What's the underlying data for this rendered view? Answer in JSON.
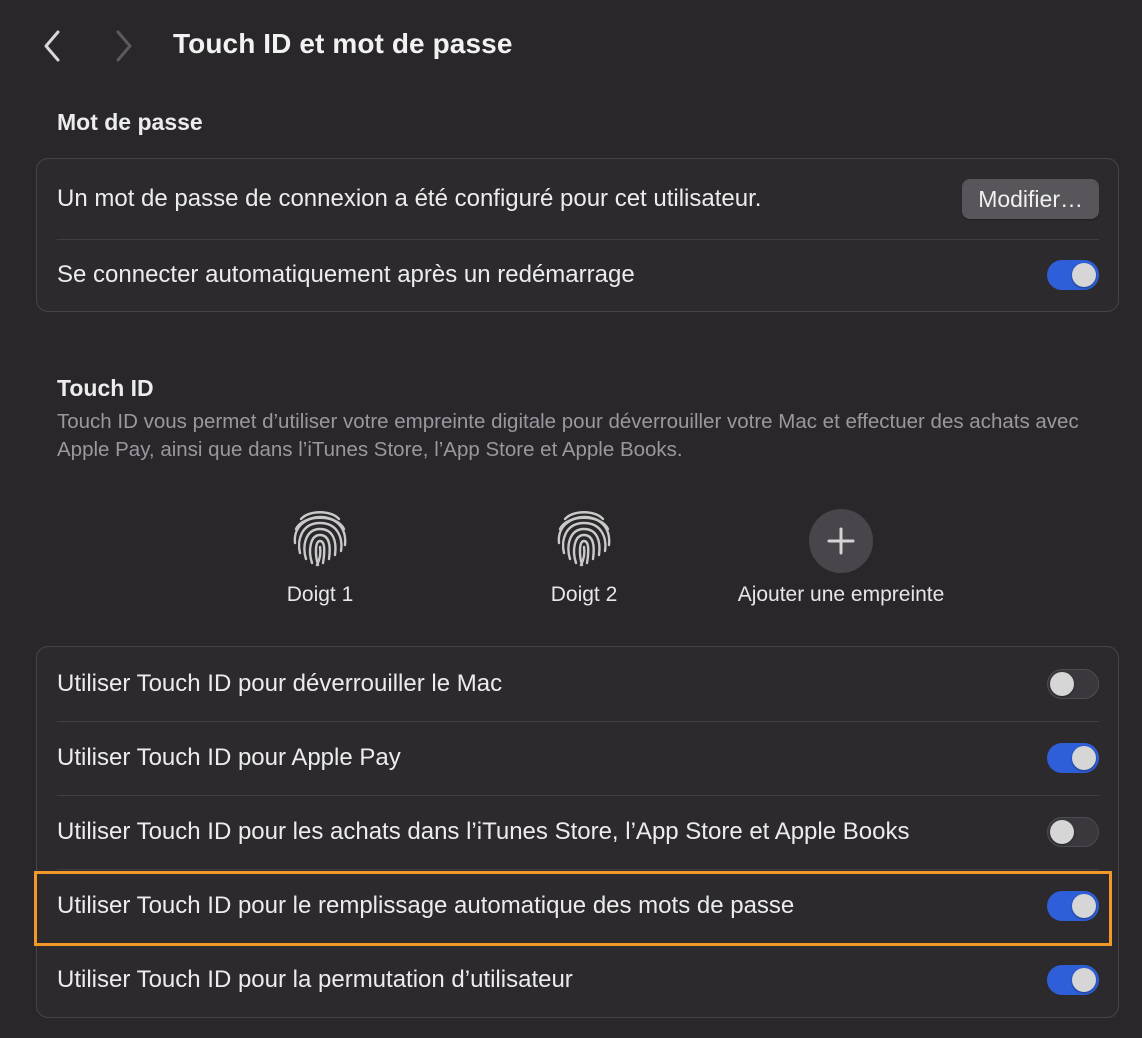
{
  "header": {
    "title": "Touch ID et mot de passe",
    "back_icon": "chevron-left-icon",
    "forward_icon": "chevron-right-icon"
  },
  "password_section": {
    "title": "Mot de passe",
    "rows": [
      {
        "label": "Un mot de passe de connexion a été configuré pour cet utilisateur.",
        "button": "Modifier…"
      },
      {
        "label": "Se connecter automatiquement après un redémarrage",
        "toggle": true
      }
    ]
  },
  "touchid_section": {
    "title": "Touch ID",
    "description": "Touch ID vous permet d’utiliser votre empreinte digitale pour déverrouiller votre Mac et effectuer des achats avec Apple Pay, ainsi que dans l’iTunes Store, l’App Store et Apple Books.",
    "fingers": [
      {
        "label": "Doigt 1",
        "icon": "fingerprint-icon"
      },
      {
        "label": "Doigt 2",
        "icon": "fingerprint-icon"
      }
    ],
    "add_label": "Ajouter une empreinte",
    "options": [
      {
        "label": "Utiliser Touch ID pour déverrouiller le Mac",
        "toggle": false
      },
      {
        "label": "Utiliser Touch ID pour Apple Pay",
        "toggle": true
      },
      {
        "label": "Utiliser Touch ID pour les achats dans l’iTunes Store, l’App Store et Apple Books",
        "toggle": false
      },
      {
        "label": "Utiliser Touch ID pour le remplissage automatique des mots de passe",
        "toggle": true
      },
      {
        "label": "Utiliser Touch ID pour la permutation d’utilisateur",
        "toggle": true
      }
    ]
  },
  "colors": {
    "background": "#2a272b",
    "toggle_on": "#2f5fd8",
    "highlight": "#f0982a"
  }
}
